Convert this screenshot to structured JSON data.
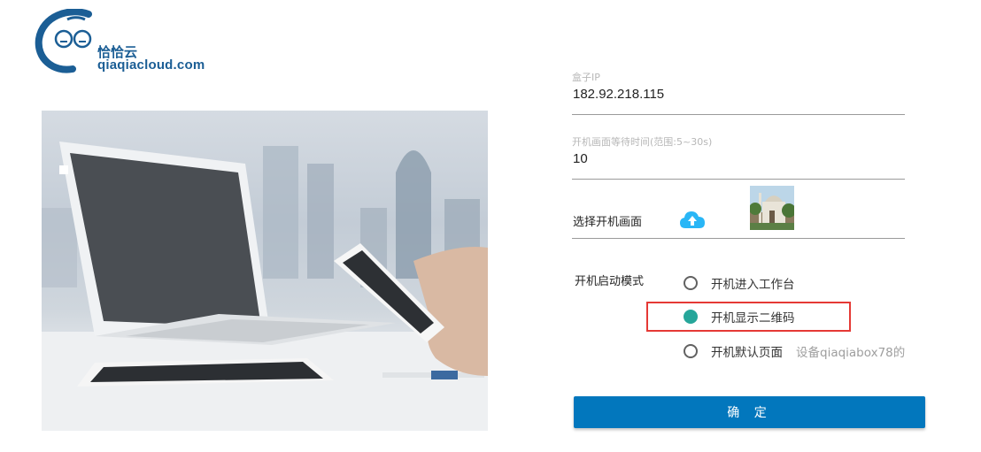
{
  "logo": {
    "cn_name": "恰恰云",
    "domain": "qiaqiacloud.com",
    "brand_color": "#1b5e95"
  },
  "form": {
    "ip": {
      "label": "盒子IP",
      "value": "182.92.218.115"
    },
    "wait": {
      "label": "开机画面等待时间(范围:5~30s)",
      "value": "10"
    },
    "boot_image": {
      "label": "选择开机画面",
      "upload_icon": "cloud-upload-icon"
    },
    "boot_mode": {
      "label": "开机启动模式",
      "options": [
        {
          "label": "开机进入工作台",
          "checked": false
        },
        {
          "label": "开机显示二维码",
          "checked": true
        },
        {
          "label": "开机默认页面",
          "note": "设备qiaqiabox78的",
          "checked": false
        }
      ]
    },
    "submit_label": "确 定"
  },
  "colors": {
    "accent": "#0277bd",
    "radio_checked": "#26a69a",
    "highlight": "#e53935"
  }
}
